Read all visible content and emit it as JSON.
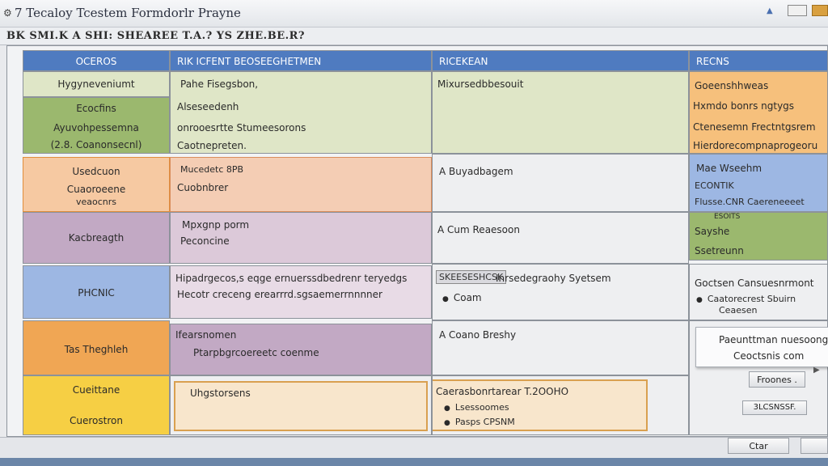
{
  "window": {
    "title": "7 Tecaloy Tcestem Formdorlr Prayne",
    "menu_text": "BK SMI.K A SHI: SHEAREE T.A.? YS ZHE.BE.R?"
  },
  "table": {
    "col_headers": [
      "OCEROS",
      "RIK ICFENT BEOSEEGHETMEN",
      "RICEKEAN",
      "RECNS"
    ],
    "rows": [
      {
        "label_lines": [
          "Hygyneveniumt"
        ],
        "col2_lines": [
          "Pahe Fisegsbon,"
        ],
        "col3_lines": [
          "Mixursedbbesouit"
        ],
        "col4_lines": [
          "Goeenshhweas"
        ]
      },
      {
        "label_lines": [
          "Ecocfins",
          "Ayuvohpessemna",
          "(2.8. Coanonsecnl)"
        ],
        "col2_lines": [
          "Alseseedenh",
          "onrooesrtte Stumeesorons",
          "Caotnepreten."
        ],
        "col3_lines": [],
        "col4_lines": [
          "Hxmdo bonrs ngtygs",
          "Ctenesemn Frectntgsrem",
          "Hierdorecompnaprogeoru"
        ]
      },
      {
        "label_lines": [
          "Usedcuon",
          "Cuaoroeene",
          "veaocnrs"
        ],
        "col2_lines": [
          "Mucedetc 8PB",
          "Cuobnbrer"
        ],
        "col3_lines": [
          "A Buyadbagem"
        ],
        "col4_lines": [
          "Mae Wseehm",
          "ECONTIK",
          "Flusse.CNR Caereneeeet"
        ]
      },
      {
        "label_lines": [
          "Kacbreagth"
        ],
        "col2_lines": [
          "Mpxgnp porm",
          "Peconcine"
        ],
        "col3_lines": [
          "A Cum Reaesoon"
        ],
        "col4_lines": [
          "ESOITS",
          "Sayshe",
          "Ssetreunn"
        ]
      },
      {
        "label_lines": [
          "PHCNIC"
        ],
        "col2_lines": [
          "Hipadrgecos,s eqge ernuerssdbedrenr teryedgs",
          "Hecotr creceng erearrrd.sgsaemerrnnnner"
        ],
        "col3_tag": "SKEESESHCSK",
        "col3_lines": [
          "Inrsedegraohy Syetsem",
          "Coam"
        ],
        "col4_lines": [
          "Goctsen Cansuesnrmont",
          "Caatorecrest Sbuirn",
          "Ceaesen"
        ]
      },
      {
        "label_lines": [
          "Tas Theghleh"
        ],
        "col2_lines": [
          "Ifearsnomen",
          "Ptarpbgrcoereetc coenme"
        ],
        "col3_lines": [
          "A Coano Breshy"
        ],
        "col4_lines": []
      },
      {
        "label_lines": [
          "Cueittane",
          "Cuerostron"
        ],
        "col2_lines": [
          "Uhgstorsens"
        ],
        "col3_lines": [
          "Caerasbonrtarear T.2OOHO",
          "Lsessoomes",
          "Pasps CPSNM"
        ],
        "col4_lines": []
      }
    ]
  },
  "popup": {
    "line1": "Paeunttman nuesoongre",
    "line2": "Ceoctsnis com"
  },
  "buttons": {
    "frodes": "Froones .",
    "side": "3LCSNSSF.",
    "ok": "Ctar",
    "extra": ""
  },
  "colors": {
    "header_blue": "#4f7bc0",
    "green_light": "#dfe6c7",
    "green_mid": "#9bb86e",
    "orange_light": "#f6c9a2",
    "orange": "#f0a654",
    "purple_light": "#dcc9d9",
    "purple": "#c2a9c4",
    "blue_light": "#9db7e3",
    "yellow": "#f6cf44",
    "peach": "#f8e6cc"
  }
}
